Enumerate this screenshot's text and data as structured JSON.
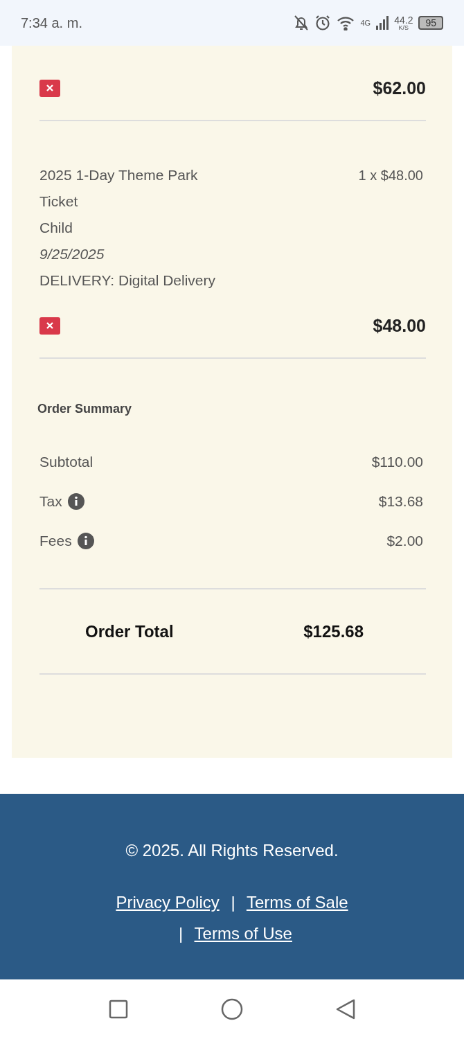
{
  "status_bar": {
    "time": "7:34 a. m.",
    "network": "4G",
    "speed": "44.2",
    "speed_unit": "K/S",
    "battery": "95"
  },
  "cart_items": [
    {
      "price": "$62.00"
    },
    {
      "details": [
        {
          "text": "2025 1-Day Theme Park Ticket",
          "kind": "plain"
        },
        {
          "text": "Child",
          "kind": "plain"
        },
        {
          "text": "9/25/2025",
          "kind": "date"
        },
        {
          "text": "DELIVERY: Digital Delivery",
          "kind": "plain"
        }
      ],
      "quantity": "1 x $48.00",
      "price": "$48.00"
    }
  ],
  "order_summary": {
    "title": "Order Summary",
    "rows": [
      {
        "label": "Subtotal",
        "value": "$110.00",
        "info": false
      },
      {
        "label": "Tax",
        "value": "$13.68",
        "info": true
      },
      {
        "label": "Fees",
        "value": "$2.00",
        "info": true
      }
    ],
    "total_label": "Order Total",
    "total_value": "$125.68"
  },
  "footer": {
    "copyright": "© 2025. All Rights Reserved.",
    "links": [
      "Privacy Policy",
      "Terms of Sale",
      "Terms of Use"
    ],
    "separator": "|"
  }
}
